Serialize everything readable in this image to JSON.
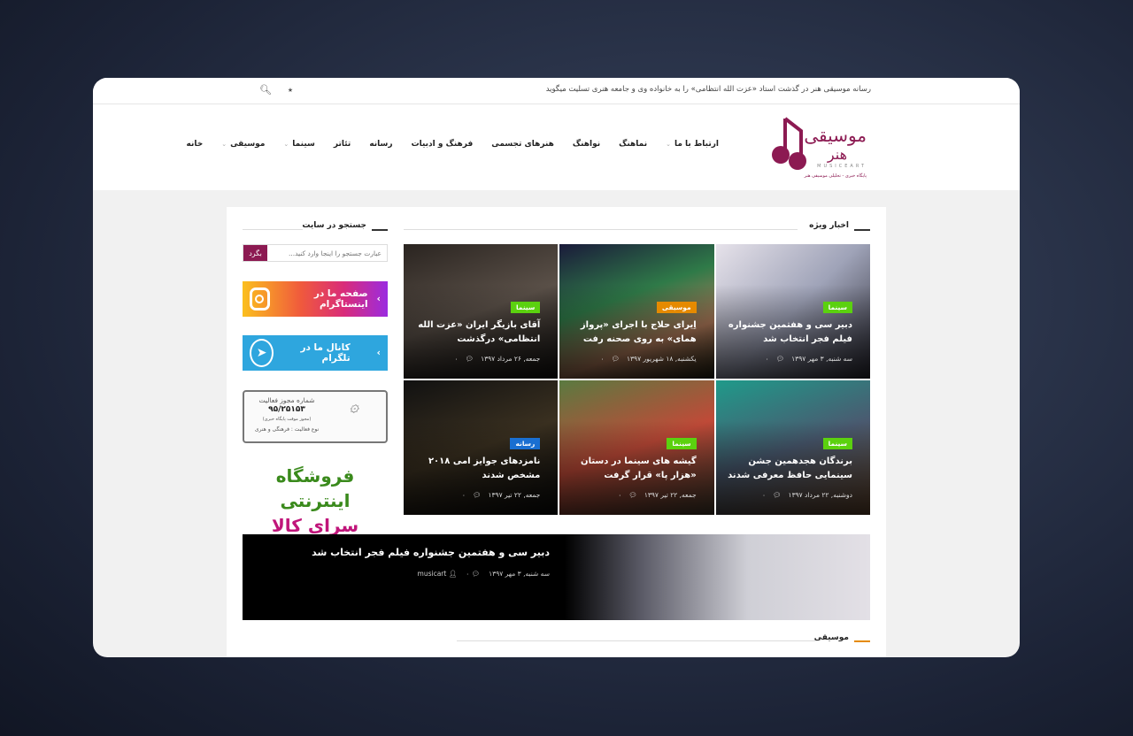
{
  "topbar": {
    "ticker": "رسانه موسیقی هنر در گذشت استاد «عزت الله انتظامی» را به خانواده وی و جامعه هنری تسلیت میگوید",
    "share_icon": "share-icon",
    "search_icon": "search-icon"
  },
  "logo": {
    "name": "موسیقی هنر",
    "latin": "MUSICEART",
    "tagline": "پایگاه خبری - تحلیلی موسیقی هنر"
  },
  "nav": [
    {
      "label": "خانه"
    },
    {
      "label": "موسیقی",
      "dropdown": true
    },
    {
      "label": "سینما",
      "dropdown": true
    },
    {
      "label": "تئاتر"
    },
    {
      "label": "رسانه"
    },
    {
      "label": "فرهنگ و ادبیات"
    },
    {
      "label": "هنرهای تجسمی"
    },
    {
      "label": "نواهنگ"
    },
    {
      "label": "نماهنگ"
    },
    {
      "label": "ارتباط با ما",
      "dropdown": true
    }
  ],
  "featured": {
    "title": "اخبار ویژه",
    "cards": [
      {
        "category": "سینما",
        "color": "#5bd10f",
        "title": "دبیر سی و هفتمین جشنواره فیلم فجر انتخاب شد",
        "date": "سه شنبه, ۳ مهر ۱۳۹۷",
        "comments": "۰"
      },
      {
        "category": "موسیقی",
        "color": "#e58a00",
        "title": "اِیرای حلاج با اجرای «پرواز همای» به روی صحنه رفت",
        "date": "یکشنبه, ۱۸ شهریور ۱۳۹۷",
        "comments": "۰"
      },
      {
        "category": "سینما",
        "color": "#5bd10f",
        "title": "آقای بازیگر ایران «عزت الله انتظامی» درگذشت",
        "date": "جمعه, ۲۶ مرداد ۱۳۹۷",
        "comments": "۰"
      },
      {
        "category": "سینما",
        "color": "#5bd10f",
        "title": "برندگان هجدهمین جشن سینمایی حافظ معرفی شدند",
        "date": "دوشنبه, ۲۲ مرداد ۱۳۹۷",
        "comments": "۰"
      },
      {
        "category": "سینما",
        "color": "#5bd10f",
        "title": "گیشه های سینما در دستان «هزار پا» قرار گرفت",
        "date": "جمعه, ۲۲ تیر ۱۳۹۷",
        "comments": "۰"
      },
      {
        "category": "رسانه",
        "color": "#1a6fd1",
        "title": "نامزدهای جوایز امی ۲۰۱۸ مشخص شدند",
        "date": "جمعه, ۲۲ تیر ۱۳۹۷",
        "comments": "۰"
      }
    ]
  },
  "sidebar": {
    "search_title": "جستجو در سایت",
    "search_placeholder": "عبارت جستجو را اینجا وارد کنید...",
    "search_button": "بگرد",
    "instagram": "صفحه ما در اینستاگرام",
    "telegram": "کانال ما در تلگرام",
    "license": {
      "title": "شماره مجوز فعالیت",
      "number": "۹۵/۲۵۱۵۳",
      "note": "(مجوز موقت پایگاه خبری)",
      "type": "نوع فعالیت : فرهنگی و هنری"
    },
    "shop_line1": "فروشگاه اینترنتی",
    "shop_line2": "سرای کالا"
  },
  "banner": {
    "title": "دبیر سی و هفتمین جشنواره فیلم فجر انتخاب شد",
    "date": "سه شنبه, ۳ مهر ۱۳۹۷",
    "comments": "۰",
    "author": "musicart"
  },
  "music_section": {
    "title": "موسیقی"
  }
}
